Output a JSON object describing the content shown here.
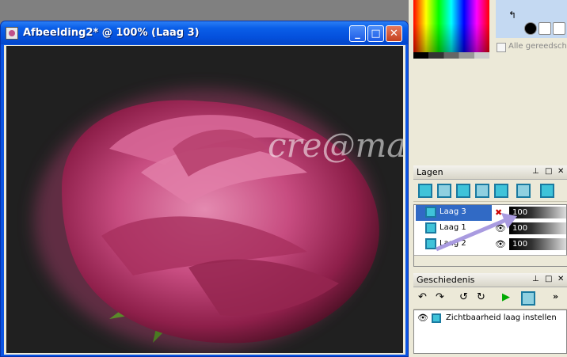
{
  "document_window": {
    "title": "Afbeelding2* @ 100% (Laag 3)",
    "buttons": {
      "minimize": "_",
      "maximize": "□",
      "close": "✕"
    },
    "watermark": "cre@maorylis",
    "image_subject": "pink-rose-on-dark-background"
  },
  "color_panel": {
    "option_label": "Alle gereedschap"
  },
  "layers_panel": {
    "title": "Lagen",
    "controls": {
      "pin": "⊥",
      "restore": "□",
      "close": "✕"
    },
    "layers": [
      {
        "name": "Laag 3",
        "opacity": "100",
        "selected": true
      },
      {
        "name": "Laag 1",
        "opacity": "100",
        "selected": false
      },
      {
        "name": "Laag 2",
        "opacity": "100",
        "selected": false
      }
    ]
  },
  "history_panel": {
    "title": "Geschiedenis",
    "controls": {
      "pin": "⊥",
      "restore": "□",
      "close": "✕"
    },
    "more": "»",
    "items": [
      {
        "label": "Zichtbaarheid laag instellen"
      }
    ]
  },
  "colors": {
    "titlebar": "#0a5ee8",
    "selection": "#316ac5",
    "rose": "#c0407a"
  }
}
